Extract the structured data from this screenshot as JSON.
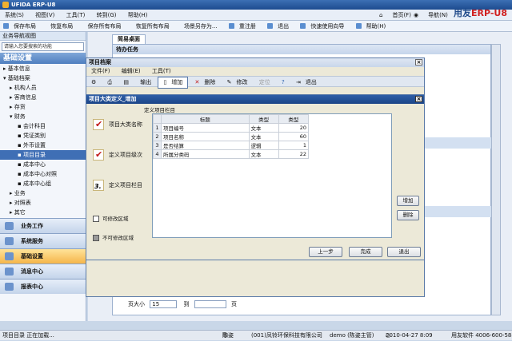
{
  "window": {
    "title": "UFIDA ERP-U8"
  },
  "menu": {
    "items": [
      "系统(S)",
      "视图(V)",
      "工具(T)",
      "转到(G)",
      "帮助(H)"
    ],
    "right": [
      "首页(F)",
      "导航(N)"
    ],
    "brand_prefix": "用友",
    "brand_suffix": "ERP-U8"
  },
  "toolbar": {
    "items": [
      "保存布局",
      "恢复布局",
      "保存所有布局",
      "恢复所有布局",
      "场景另存为...",
      "重注册",
      "退出",
      "快速使用向导",
      "帮助(H)"
    ]
  },
  "left_panel": {
    "header": "业务导航视图",
    "search_placeholder": "请输入您要搜索的功能",
    "section_title": "基础设置",
    "tree": [
      "基本信息",
      "基础档案",
      "机构人员",
      "客商信息",
      "存货",
      "财务",
      "会计科目",
      "凭证类别",
      "外币设置",
      "项目目录",
      "成本中心",
      "成本中心对照",
      "成本中心组",
      "业务",
      "对照表",
      "其它"
    ],
    "nav_buttons": [
      "业务工作",
      "系统服务",
      "基础设置",
      "消息中心",
      "报表中心"
    ]
  },
  "main": {
    "tab": "简易桌面",
    "section": "待办任务",
    "page_size_label": "页大小",
    "page_size_value": "15",
    "goto_label": "到",
    "page_unit": "页",
    "ok_button": "确定"
  },
  "outer_dialog": {
    "title": "项目档案",
    "menu": [
      "文件(F)",
      "编辑(E)",
      "工具(T)"
    ],
    "tools": [
      "设置",
      "打印",
      "预览",
      "输出",
      "增加",
      "删除",
      "修改",
      "定位",
      "帮助",
      "退出"
    ]
  },
  "wizard": {
    "title": "项目大类定义_增加",
    "steps": [
      "项目大类名称",
      "定义项目级次",
      "定义项目栏目"
    ],
    "checkbox_editable": "可修改区域",
    "checkbox_readonly": "不可修改区域",
    "group_label": "定义项目栏目",
    "columns": [
      "标题",
      "类型",
      "类型"
    ],
    "rows": [
      {
        "n": "1",
        "title": "项目编号",
        "type": "文本",
        "len": "20"
      },
      {
        "n": "2",
        "title": "项目名称",
        "type": "文本",
        "len": "60"
      },
      {
        "n": "3",
        "title": "是否结算",
        "type": "逻辑",
        "len": "1"
      },
      {
        "n": "4",
        "title": "所属分类码",
        "type": "文本",
        "len": "22"
      }
    ],
    "btn_add": "增加",
    "btn_delete": "删除",
    "btn_prev": "上一步",
    "btn_finish": "完成",
    "btn_exit": "退出"
  },
  "status": {
    "left": "项目目录 正在加载...",
    "user": "陈姿",
    "company": "(001)凤铃环保科技有限公司",
    "account": "demo (陈姿主管)",
    "datetime": "2010-04-27 8:09",
    "vendor": "用友软件 4006-600-588"
  }
}
